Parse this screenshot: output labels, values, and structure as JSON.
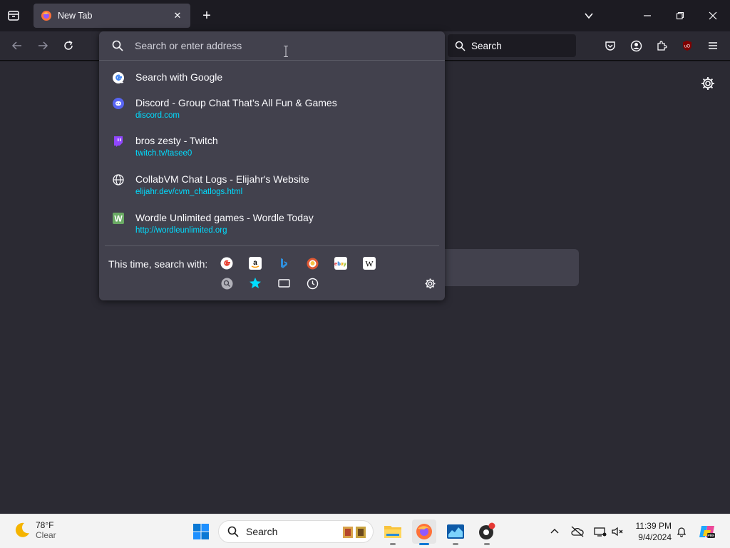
{
  "tabbar": {
    "tab_title": "New Tab"
  },
  "navbar": {
    "search_label": "Search"
  },
  "urlbar": {
    "placeholder": "Search or enter address",
    "results": [
      {
        "title": "Search with Google",
        "url": "",
        "icon": "google-icon"
      },
      {
        "title": "Discord - Group Chat That’s All Fun & Games",
        "url": "discord.com",
        "icon": "discord-icon"
      },
      {
        "title": "bros zesty - Twitch",
        "url": "twitch.tv/tasee0",
        "icon": "twitch-icon"
      },
      {
        "title": "CollabVM Chat Logs - Elijahr's Website",
        "url": "elijahr.dev/cvm_chatlogs.html",
        "icon": "globe-icon"
      },
      {
        "title": "Wordle Unlimited games - Wordle Today",
        "url": "http://wordleunlimited.org",
        "icon": "wordle-icon"
      }
    ],
    "oneoff_label": "This time, search with:",
    "engines": [
      "google",
      "amazon",
      "bing",
      "duckduckgo",
      "ebay",
      "wikipedia"
    ],
    "local_modes": [
      "search-icon",
      "bookmarks-icon",
      "tabs-icon",
      "history-icon"
    ]
  },
  "taskbar": {
    "weather_temp": "78°F",
    "weather_cond": "Clear",
    "search_label": "Search",
    "clock_time": "11:39 PM",
    "clock_date": "9/4/2024"
  },
  "colors": {
    "accent_link": "#00ddff",
    "panel": "#42414d",
    "toolbar": "#2b2a33",
    "frame": "#1c1b22"
  }
}
